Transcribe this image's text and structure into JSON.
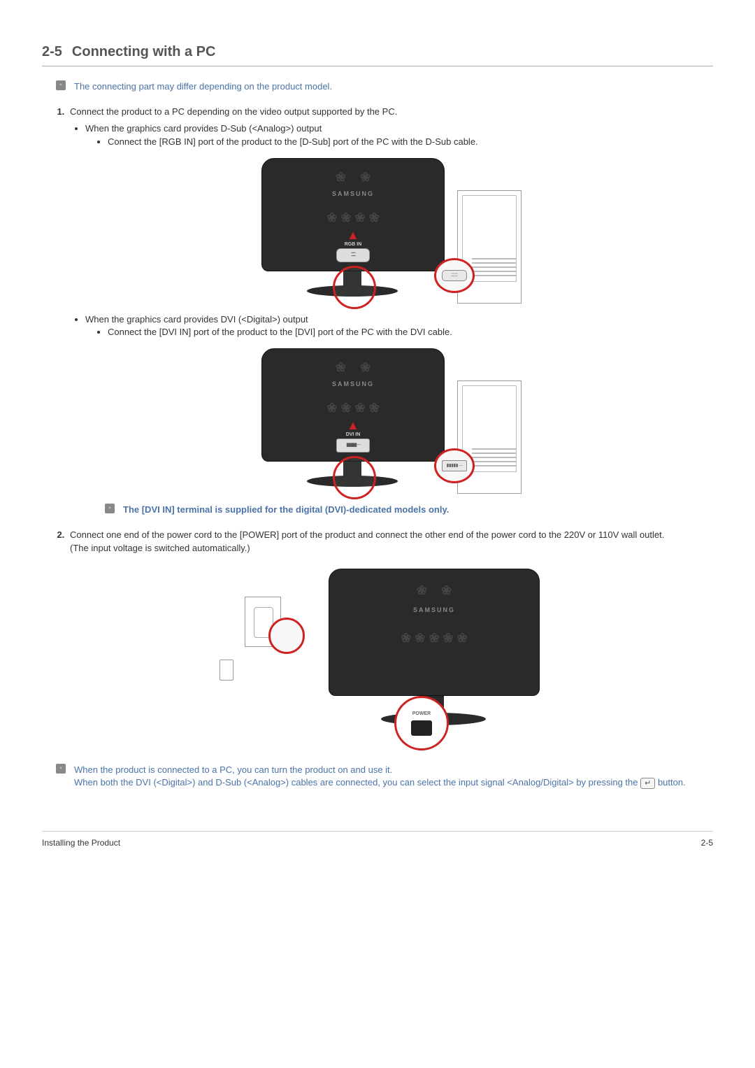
{
  "header": {
    "section_number": "2-5",
    "title": "Connecting with a PC"
  },
  "notes": {
    "model_differ": "The connecting part may differ depending on the product model.",
    "dvi_only": "The [DVI IN] terminal is supplied for the digital (DVI)-dedicated models only.",
    "final_note_line1": "When the product is connected to a PC, you can turn the product on and use it.",
    "final_note_line2a": "When both the DVI (<Digital>) and D-Sub (<Analog>) cables are connected, you can select the input signal <Analog/Digital> by pressing the ",
    "final_note_line2b": " button."
  },
  "steps": {
    "step1": "Connect the product to a PC depending on the video output supported by the PC.",
    "step1_sub_a": "When the graphics card provides D-Sub (<Analog>) output",
    "step1_sub_a_sub": "Connect the [RGB IN] port of the product to the [D-Sub] port of the PC with the D-Sub cable.",
    "step1_sub_b": "When the graphics card provides DVI (<Digital>) output",
    "step1_sub_b_sub": "Connect the [DVI IN] port of the product to the [DVI] port of the PC with the DVI cable.",
    "step2_a": "Connect one end of the power cord to the [POWER] port of the product and connect the other end of the power cord to the 220V or 110V wall outlet.",
    "step2_b": "(The input voltage is switched automatically.)"
  },
  "labels": {
    "brand": "SAMSUNG",
    "rgb_in": "RGB IN",
    "dvi_in": "DVI IN",
    "power": "POWER",
    "enter_glyph": "↵",
    "vga_dots": "⁚⁚⁚⁚⁚",
    "dvi_dots": "▮▮▮▮▮ ─"
  },
  "footer": {
    "left": "Installing the Product",
    "right": "2-5"
  }
}
